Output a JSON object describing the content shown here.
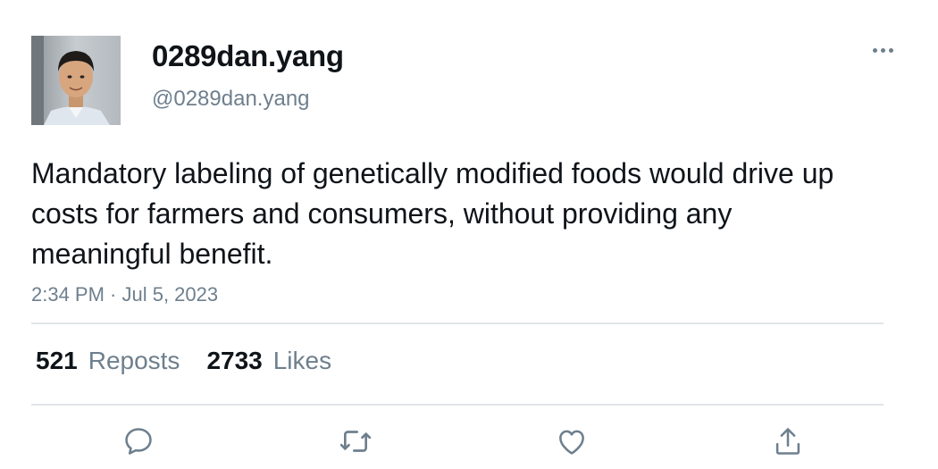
{
  "user": {
    "display_name": "0289dan.yang",
    "handle": "@0289dan.yang"
  },
  "tweet": {
    "text": "Mandatory labeling of genetically modified foods would drive up costs for farmers and consumers, without providing any meaningful benefit.",
    "timestamp": "2:34 PM · Jul 5, 2023"
  },
  "stats": {
    "reposts_count": "521",
    "reposts_label": "Reposts",
    "likes_count": "2733",
    "likes_label": "Likes"
  },
  "icons": {
    "more": "more-horizontal-icon",
    "reply": "reply-icon",
    "repost": "repost-icon",
    "like": "heart-icon",
    "share": "share-icon"
  },
  "colors": {
    "text_primary": "#0f1419",
    "text_secondary": "#6e7f8d",
    "divider": "#e1e5e8"
  }
}
